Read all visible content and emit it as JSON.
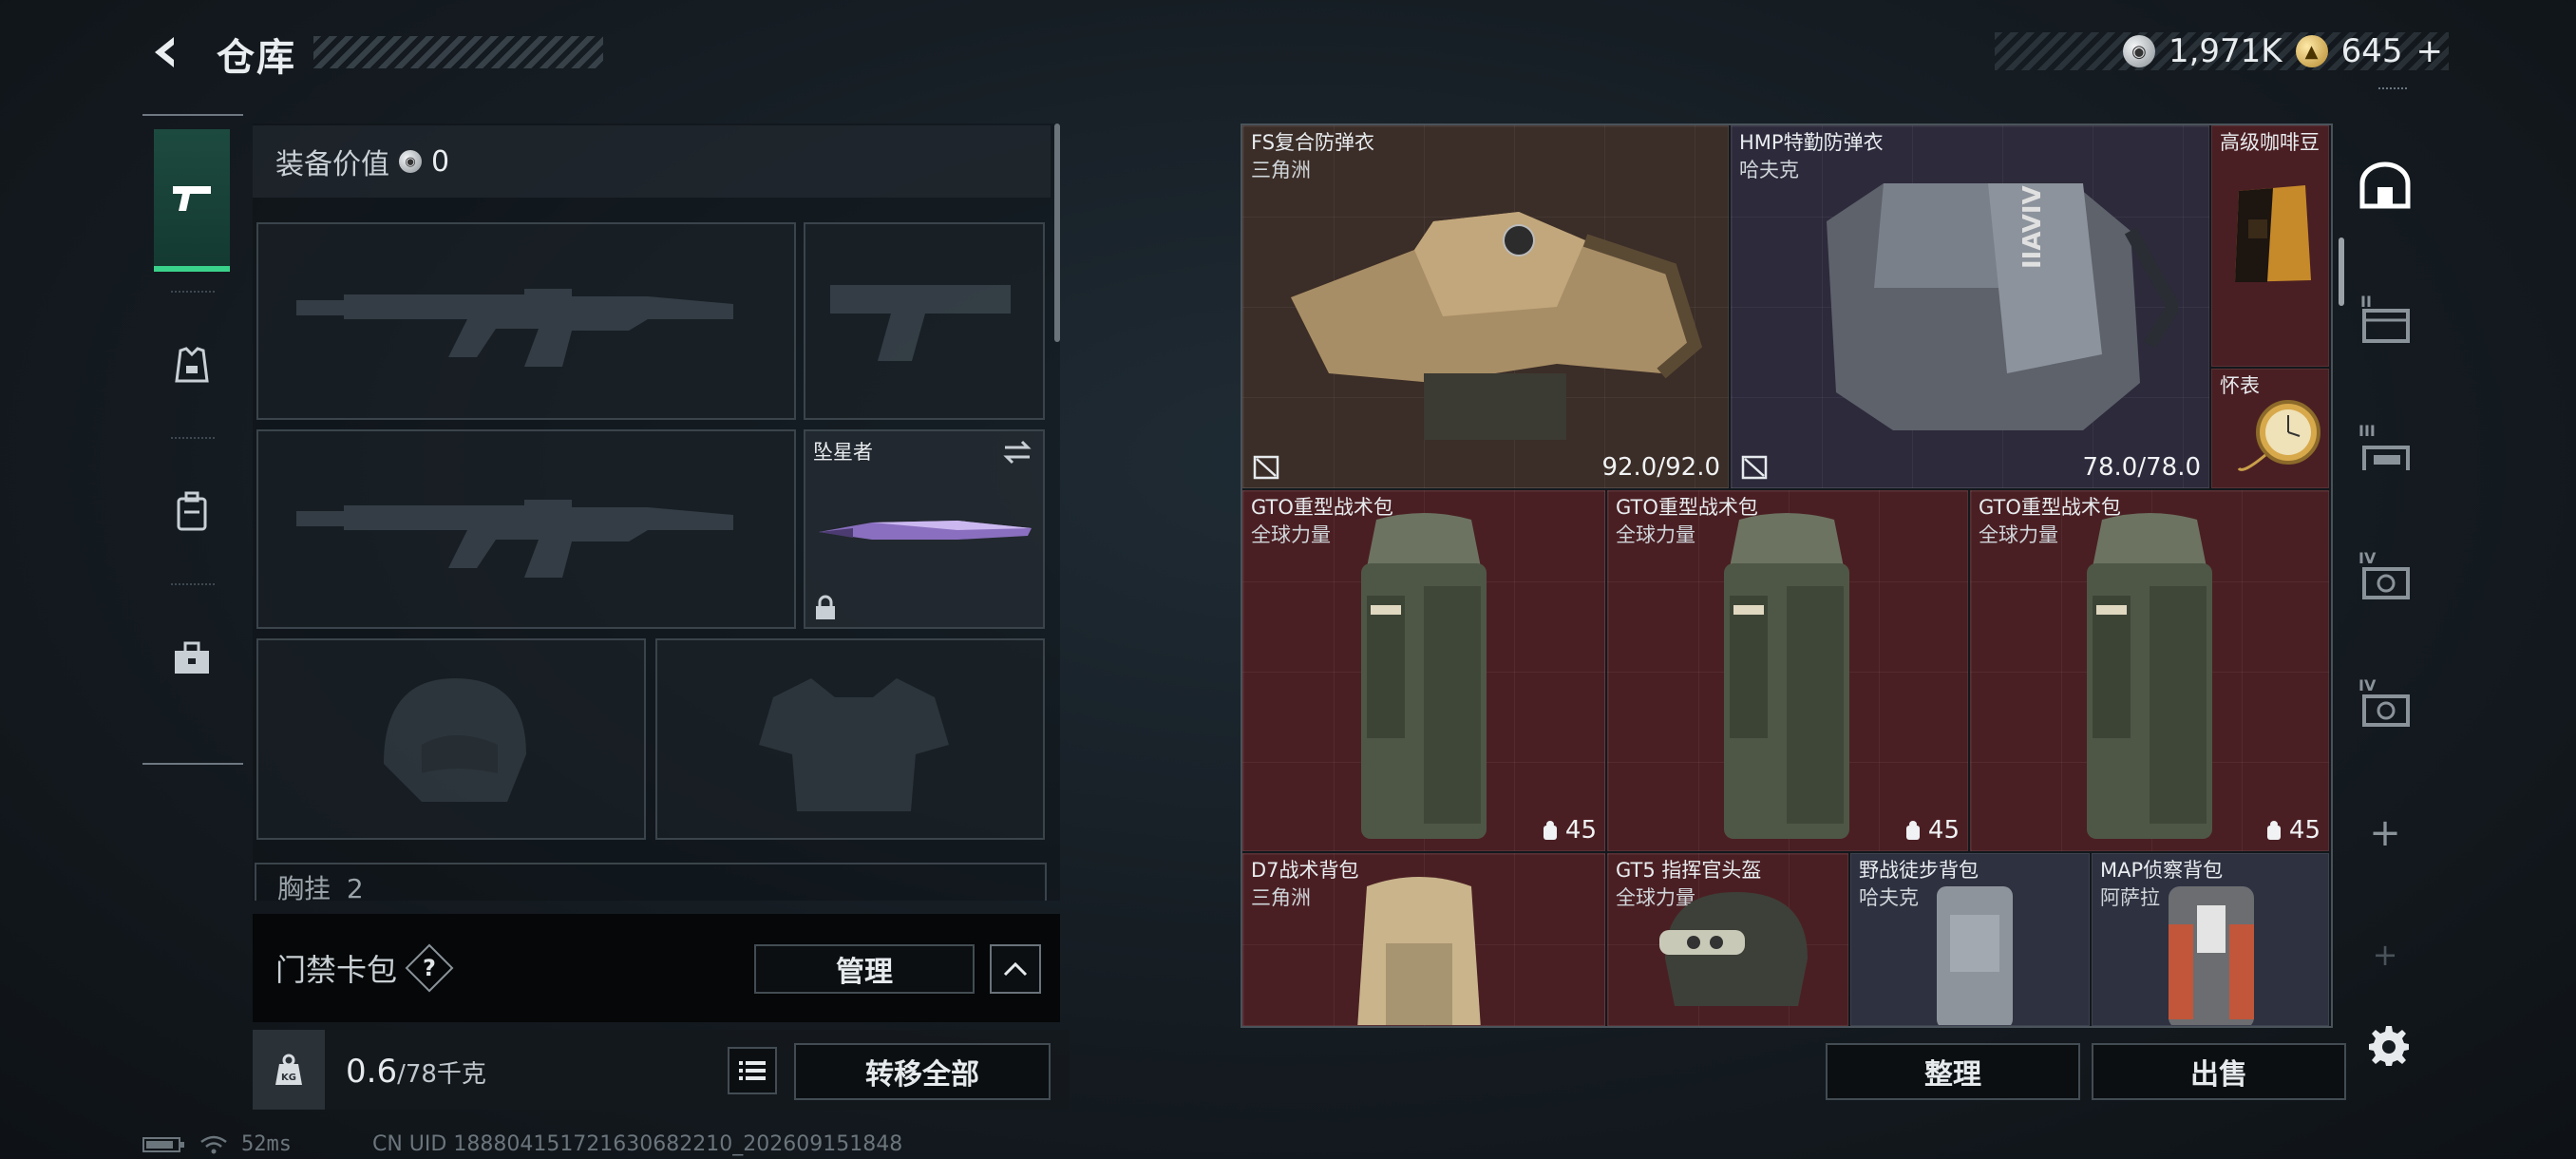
{
  "header": {
    "title": "仓库",
    "currencies": [
      {
        "icon": "silver-coin-icon",
        "value": "1,971K"
      },
      {
        "icon": "gold-coin-icon",
        "value": "645",
        "add": "+"
      }
    ]
  },
  "loadout": {
    "equip_value_label": "装备价值",
    "equip_value": "0",
    "melee": {
      "name": "坠星者"
    },
    "chest_rig_label": "胸挂",
    "chest_rig_count": "2",
    "card_pack_label": "门禁卡包",
    "help_label": "?",
    "manage_label": "管理",
    "weight": "0.6",
    "weight_max": "/78千克",
    "weight_icon_label": "KG",
    "transfer_all_label": "转移全部"
  },
  "status": {
    "ping": "52ms",
    "uid": "CN UID 1888041517216306822​10_202609151848"
  },
  "storage": {
    "items": [
      {
        "name": "FS复合防弹衣",
        "sub": "三角洲",
        "durability": "92.0/92.0"
      },
      {
        "name": "HMP特勤防弹衣",
        "sub": "哈夫克",
        "durability": "78.0/78.0"
      },
      {
        "name": "高级咖啡豆",
        "sub": ""
      },
      {
        "name": "怀表",
        "sub": ""
      },
      {
        "name": "GTO重型战术包",
        "sub": "全球力量",
        "capacity": "45"
      },
      {
        "name": "GTO重型战术包",
        "sub": "全球力量",
        "capacity": "45"
      },
      {
        "name": "GTO重型战术包",
        "sub": "全球力量",
        "capacity": "45"
      },
      {
        "name": "D7战术背包",
        "sub": "三角洲"
      },
      {
        "name": "GT5 指挥官头盔",
        "sub": "全球力量"
      },
      {
        "name": "野战徒步背包",
        "sub": "哈夫克"
      },
      {
        "name": "MAP侦察背包",
        "sub": "阿萨拉"
      }
    ],
    "sort_label": "整理",
    "sell_label": "出售"
  },
  "right_rail": {
    "tabs": [
      "II",
      "III",
      "IV",
      "IV"
    ],
    "add": "+"
  },
  "colors": {
    "accent_green": "#3ad18a",
    "rarity_maroon": "#4a1f23",
    "rarity_brown": "#3b2d27",
    "rarity_navy": "#2c2a3b"
  }
}
